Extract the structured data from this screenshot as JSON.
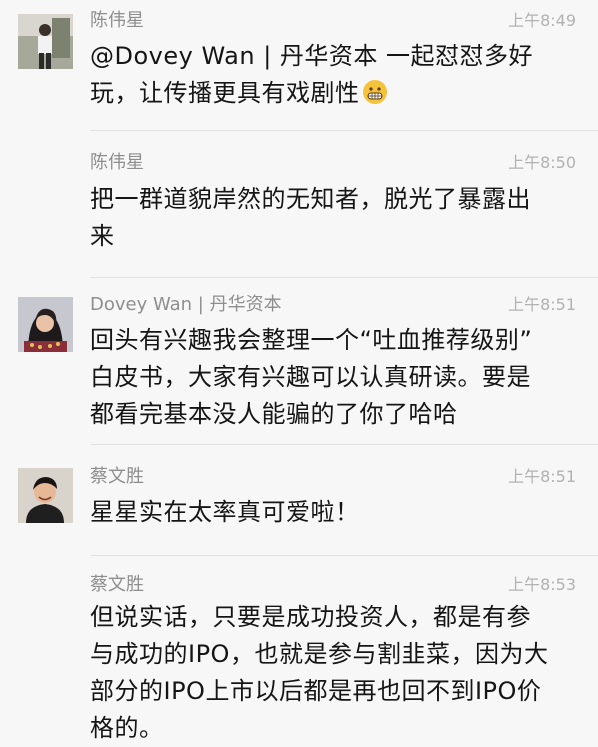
{
  "messages": [
    {
      "name": "陈伟星",
      "time": "上午8:49",
      "lines": [
        "@Dovey Wan | 丹华资本 一起怼怼多好",
        "玩，让传播更具有戏剧性"
      ],
      "emoji": "grimacing-face-emoji",
      "avatar": "avatar-photo-man-standing"
    },
    {
      "name": "陈伟星",
      "time": "上午8:50",
      "lines": [
        "把一群道貌岸然的无知者，脱光了暴露出",
        "来"
      ]
    },
    {
      "name": "Dovey Wan | 丹华资本",
      "time": "上午8:51",
      "lines": [
        "回头有兴趣我会整理一个“吐血推荐级别”",
        "白皮书，大家有兴趣可以认真研读。要是",
        "都看完基本没人能骗的了你了哈哈"
      ],
      "avatar": "avatar-photo-woman"
    },
    {
      "name": "蔡文胜",
      "time": "上午8:51",
      "lines": [
        "星星实在太率真可爱啦！"
      ],
      "avatar": "avatar-photo-man-smiling"
    },
    {
      "name": "蔡文胜",
      "time": "上午8:53",
      "lines": [
        "但说实话，只要是成功投资人，都是有参",
        "与成功的IPO，也就是参与割韭菜，因为大",
        "部分的IPO上市以后都是再也回不到IPO价",
        "格的。"
      ]
    }
  ]
}
